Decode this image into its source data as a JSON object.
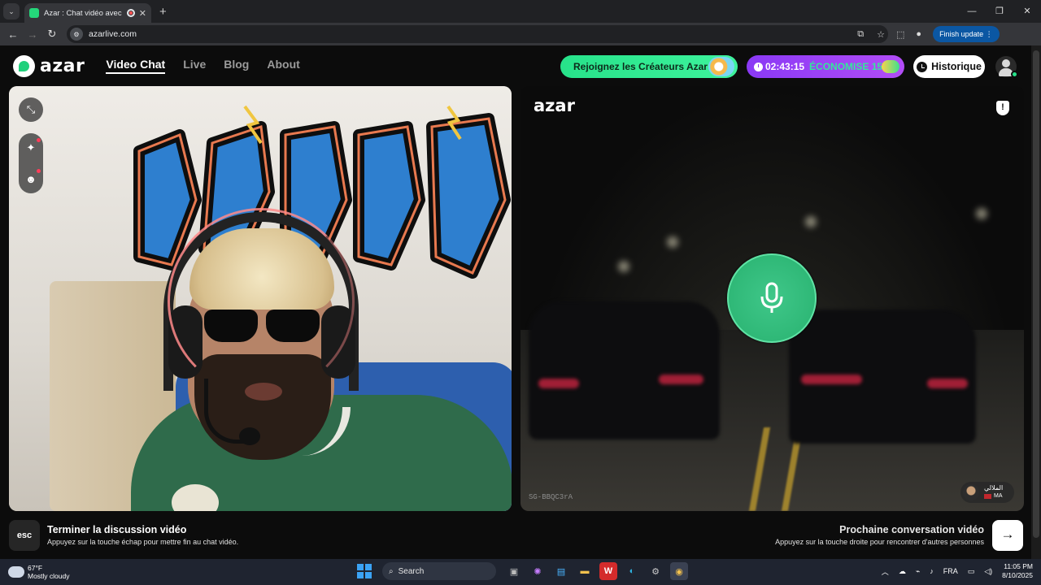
{
  "browser": {
    "tab_title": "Azar : Chat vidéo avec de n",
    "url": "azarlive.com",
    "finish_update": "Finish update"
  },
  "app": {
    "logo": "azar",
    "nav": [
      "Video Chat",
      "Live",
      "Blog",
      "About"
    ],
    "creators_btn": "Rejoignez les Créateurs Azar",
    "promo_timer": "02:43:15",
    "promo_save": "ÉCONOMISE 15%",
    "history_btn": "Historique"
  },
  "peer": {
    "logo": "azar",
    "session_id": "SG-BBQC3rA",
    "name": "الملالي",
    "country": "MA"
  },
  "bottom": {
    "esc_key": "esc",
    "end_title": "Terminer la discussion vidéo",
    "end_sub": "Appuyez sur la touche échap pour mettre fin au chat vidéo.",
    "next_title": "Prochaine conversation vidéo",
    "next_sub": "Appuyez sur la touche droite pour rencontrer d'autres personnes",
    "next_arrow": "→"
  },
  "taskbar": {
    "weather_temp": "67°F",
    "weather_desc": "Mostly cloudy",
    "search": "Search",
    "lang": "FRA",
    "time": "11:05 PM",
    "date": "8/10/2025"
  },
  "colors": {
    "azar_green": "#27e28a",
    "promo_purple": "#8a39f5",
    "mic_green": "#2fb877"
  }
}
